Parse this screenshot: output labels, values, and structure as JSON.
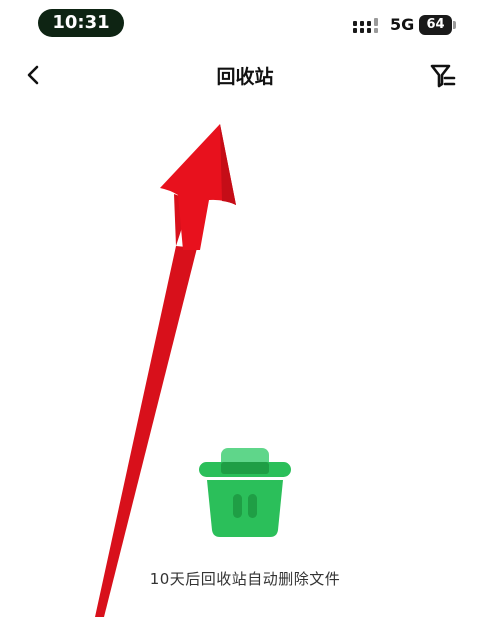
{
  "status_bar": {
    "time": "10:31",
    "network": "5G",
    "battery": "64"
  },
  "nav": {
    "title": "回收站",
    "back_icon": "chevron-left-icon",
    "filter_icon": "filter-icon"
  },
  "empty_state": {
    "icon": "trash-bin-icon",
    "message": "10天后回收站自动删除文件"
  },
  "colors": {
    "trash_dark": "#1f9e45",
    "trash_mid": "#2bbf5a",
    "trash_light": "#5fd68a",
    "annotation_arrow": "#e8111d"
  }
}
